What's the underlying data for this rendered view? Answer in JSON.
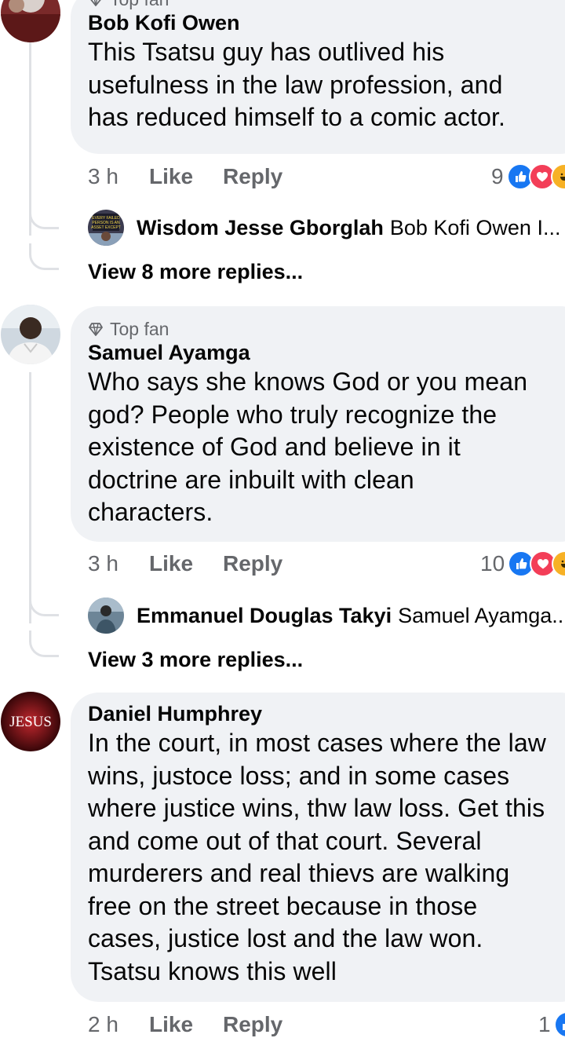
{
  "comments": [
    {
      "badge": "Top fan",
      "author": "Bob Kofi Owen",
      "text": "This Tsatsu guy has outlived his\nusefulness in the law profession, and\nhas reduced himself to a comic actor.",
      "time": "3 h",
      "like_label": "Like",
      "reply_label": "Reply",
      "reaction_count": "9",
      "reply_preview": {
        "name": "Wisdom Jesse Gborglah",
        "snippet": "Bob Kofi Owen I...",
        "avatar_text": "EVERY FAILED PERSON IS AN ASSET EXCEPT A FOOL"
      },
      "view_more": "View 8 more replies..."
    },
    {
      "badge": "Top fan",
      "author": "Samuel Ayamga",
      "text": "Who says she knows God or you mean\ngod? People who truly recognize the\nexistence of God and believe in it\ndoctrine are inbuilt with clean\ncharacters.",
      "time": "3 h",
      "like_label": "Like",
      "reply_label": "Reply",
      "reaction_count": "10",
      "reply_preview": {
        "name": "Emmanuel Douglas Takyi",
        "snippet": "Samuel Ayamga..."
      },
      "view_more": "View 3 more replies..."
    },
    {
      "author": "Daniel Humphrey",
      "avatar_text": "JESUS",
      "text": "In the court, in most cases where the law\nwins, justoce loss; and in some cases\nwhere justice wins, thw law loss. Get this\nand come out of that court. Several\nmurderers and real thievs are walking\nfree on the street because in those\ncases, justice lost and the law won.\nTsatsu knows this well",
      "time": "2 h",
      "like_label": "Like",
      "reply_label": "Reply",
      "reaction_count": "1"
    }
  ],
  "colors": {
    "bubble": "#f0f2f5",
    "secondary_text": "#65676b",
    "like": "#1877f2",
    "love": "#f33e58",
    "haha": "#f7b125"
  }
}
